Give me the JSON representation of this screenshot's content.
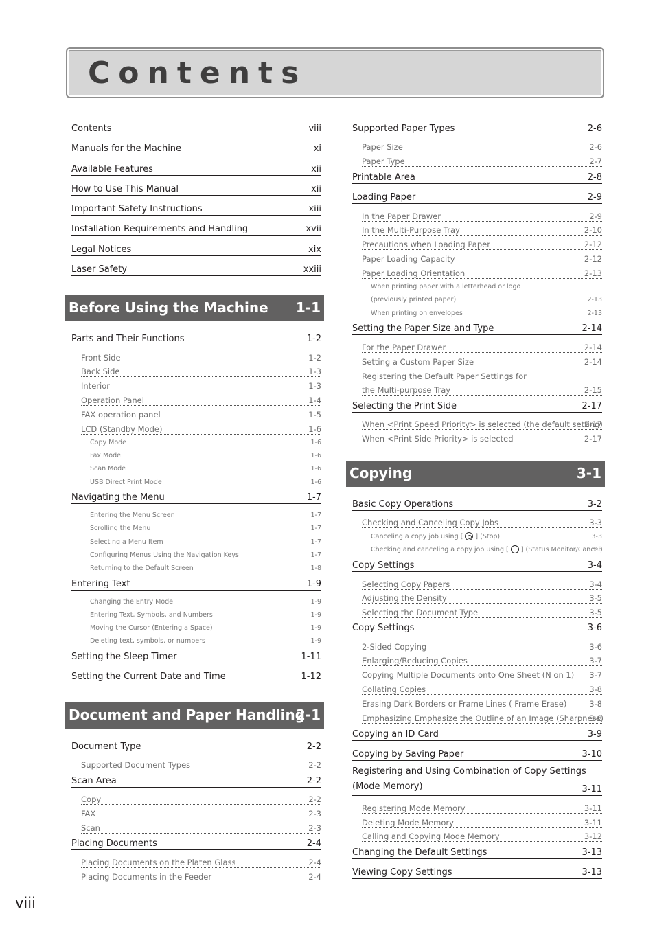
{
  "page_title": "Contents",
  "folio": "viii",
  "front_matter": [
    {
      "title": "Contents",
      "page": "viii"
    },
    {
      "title": "Manuals for the Machine",
      "page": "xi"
    },
    {
      "title": "Available Features",
      "page": "xii"
    },
    {
      "title": "How to Use This Manual",
      "page": "xii"
    },
    {
      "title": "Important Safety Instructions",
      "page": "xiii"
    },
    {
      "title": "Installation Requirements and Handling",
      "page": "xvii"
    },
    {
      "title": "Legal Notices",
      "page": "xix"
    },
    {
      "title": "Laser Safety",
      "page": "xxiii"
    }
  ],
  "chapters": [
    {
      "title": "Before Using the Machine",
      "page": "1-1",
      "entries": [
        {
          "title": "Parts and Their Functions",
          "page": "1-2"
        },
        {
          "title": "Front Side",
          "page": "1-2"
        },
        {
          "title": "Back Side",
          "page": "1-3"
        },
        {
          "title": "Interior",
          "page": "1-3"
        },
        {
          "title": "Operation Panel",
          "page": "1-4"
        },
        {
          "title": "FAX operation panel",
          "page": "1-5"
        },
        {
          "title": "LCD (Standby Mode)",
          "page": "1-6"
        },
        {
          "title": "Copy Mode",
          "page": "1-6"
        },
        {
          "title": "Fax Mode",
          "page": "1-6"
        },
        {
          "title": "Scan Mode",
          "page": "1-6"
        },
        {
          "title": "USB Direct Print Mode",
          "page": "1-6"
        },
        {
          "title": "Navigating the Menu",
          "page": "1-7"
        },
        {
          "title": "Entering the Menu Screen",
          "page": "1-7"
        },
        {
          "title": "Scrolling the Menu",
          "page": "1-7"
        },
        {
          "title": "Selecting a Menu Item",
          "page": "1-7"
        },
        {
          "title": "Configuring Menus Using the Navigation Keys",
          "page": "1-7"
        },
        {
          "title": "Returning to the Default Screen",
          "page": "1-8"
        },
        {
          "title": "Entering Text",
          "page": "1-9"
        },
        {
          "title": "Changing the Entry Mode",
          "page": "1-9"
        },
        {
          "title": "Entering Text, Symbols, and Numbers",
          "page": "1-9"
        },
        {
          "title": "Moving the Cursor (Entering a Space)",
          "page": "1-9"
        },
        {
          "title": "Deleting text, symbols, or numbers",
          "page": "1-9"
        },
        {
          "title": "Setting the Sleep Timer",
          "page": "1-11"
        },
        {
          "title": "Setting the Current Date and Time",
          "page": "1-12"
        }
      ]
    },
    {
      "title": "Document and Paper Handling",
      "page": "2-1",
      "entries": [
        {
          "title": "Document Type",
          "page": "2-2"
        },
        {
          "title": "Supported Document Types",
          "page": "2-2"
        },
        {
          "title": "Scan Area",
          "page": "2-2"
        },
        {
          "title": "Copy",
          "page": "2-2"
        },
        {
          "title": "FAX",
          "page": "2-3"
        },
        {
          "title": "Scan",
          "page": "2-3"
        },
        {
          "title": "Placing Documents",
          "page": "2-4"
        },
        {
          "title": "Placing Documents on the Platen Glass",
          "page": "2-4"
        },
        {
          "title": "Placing Documents in the Feeder",
          "page": "2-4"
        },
        {
          "title": "Supported Paper Types",
          "page": "2-6"
        },
        {
          "title": "Paper Size",
          "page": "2-6"
        },
        {
          "title": "Paper Type",
          "page": "2-7"
        },
        {
          "title": "Printable Area",
          "page": "2-8"
        },
        {
          "title": "Loading Paper",
          "page": "2-9"
        },
        {
          "title": "In the Paper Drawer",
          "page": "2-9"
        },
        {
          "title": "In the Multi-Purpose Tray",
          "page": "2-10"
        },
        {
          "title": "Precautions when Loading Paper",
          "page": "2-12"
        },
        {
          "title": "Paper Loading Capacity",
          "page": "2-12"
        },
        {
          "title": "Paper Loading Orientation",
          "page": "2-13"
        },
        {
          "title": "When printing paper with a letterhead or logo",
          "page": ""
        },
        {
          "title": "(previously printed paper)",
          "page": "2-13"
        },
        {
          "title": "When printing on envelopes",
          "page": "2-13"
        },
        {
          "title": "Setting the Paper Size and Type",
          "page": "2-14"
        },
        {
          "title": "For the Paper Drawer",
          "page": "2-14"
        },
        {
          "title": "Setting a Custom Paper Size",
          "page": "2-14"
        },
        {
          "title": "Registering the Default Paper Settings for",
          "page": ""
        },
        {
          "title": "the Multi-purpose Tray",
          "page": "2-15"
        },
        {
          "title": "Selecting the Print Side",
          "page": "2-17"
        },
        {
          "title": "When <Print Speed Priority> is selected (the default setting)",
          "page": "2-17"
        },
        {
          "title": "When <Print Side Priority> is selected",
          "page": "2-17"
        }
      ]
    },
    {
      "title": "Copying",
      "page": "3-1",
      "entries": [
        {
          "title": "Basic Copy Operations",
          "page": "3-2"
        },
        {
          "title": "Checking and Canceling Copy Jobs",
          "page": "3-3"
        },
        {
          "title_before": "Canceling a copy job using [",
          "title_after": "] (Stop)",
          "icon": "stop-icon",
          "page": "3-3"
        },
        {
          "title_before": "Checking and canceling a copy job using [",
          "title_after": "] (Status Monitor/Cancel)",
          "icon": "status-monitor-cancel-icon",
          "page": "3-3"
        },
        {
          "title": "Copy Settings",
          "page": "3-4"
        },
        {
          "title": "Selecting Copy Papers",
          "page": "3-4"
        },
        {
          "title": "Adjusting the Density",
          "page": "3-5"
        },
        {
          "title": "Selecting the Document Type",
          "page": "3-5"
        },
        {
          "title": "Copy Settings",
          "page": "3-6"
        },
        {
          "title": "2-Sided Copying",
          "page": "3-6"
        },
        {
          "title": "Enlarging/Reducing Copies",
          "page": "3-7"
        },
        {
          "title": "Copying Multiple Documents onto One Sheet (N on 1)",
          "page": "3-7"
        },
        {
          "title": "Collating Copies",
          "page": "3-8"
        },
        {
          "title": "Erasing Dark Borders or Frame Lines ( Frame Erase)",
          "page": "3-8"
        },
        {
          "title": "Emphasizing Emphasize the Outline of an Image (Sharpness)",
          "page": "3-8"
        },
        {
          "title": "Copying an ID Card",
          "page": "3-9"
        },
        {
          "title": "Copying by Saving Paper",
          "page": "3-10"
        },
        {
          "title": "Registering and Using Combination of Copy Settings (Mode Memory)",
          "page": "3-11"
        },
        {
          "title": "Registering Mode Memory",
          "page": "3-11"
        },
        {
          "title": "Deleting Mode Memory",
          "page": "3-11"
        },
        {
          "title": "Calling and Copying Mode Memory",
          "page": "3-12"
        },
        {
          "title": "Changing the Default Settings",
          "page": "3-13"
        },
        {
          "title": "Viewing Copy Settings",
          "page": "3-13"
        }
      ]
    }
  ]
}
